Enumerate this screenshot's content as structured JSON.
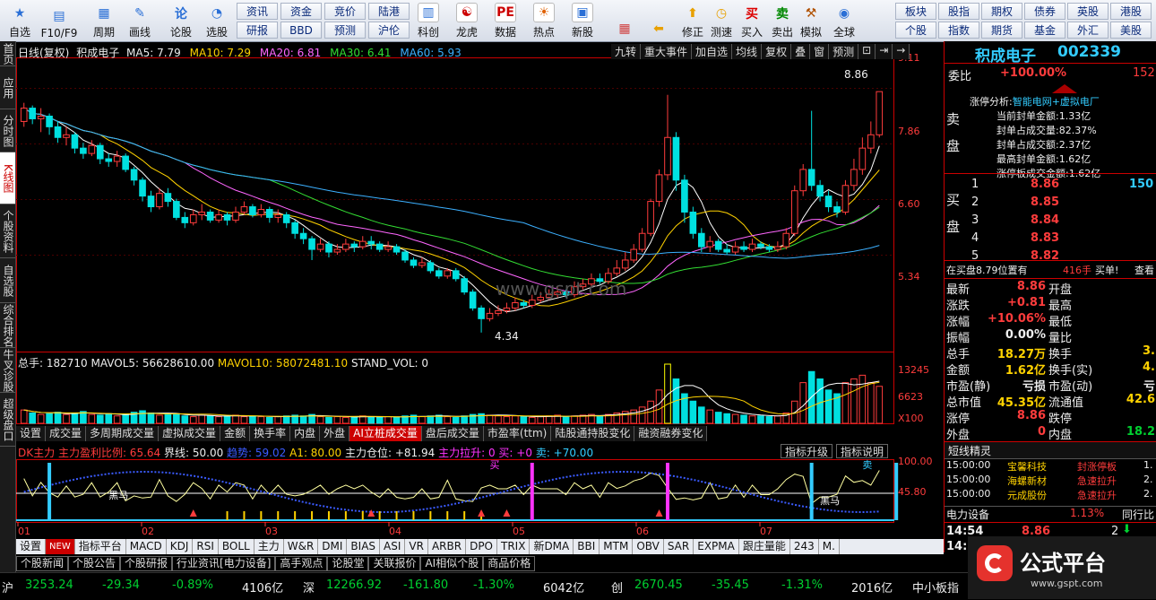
{
  "toolbar": {
    "big_buttons": [
      {
        "label": "自选",
        "icon": "star-icon",
        "x": 2
      },
      {
        "label": "F10/F9",
        "icon": "f10-icon",
        "x": 46
      },
      {
        "label": "周期",
        "icon": "period-icon",
        "x": 96
      },
      {
        "label": "画线",
        "icon": "pencil-icon",
        "x": 136
      },
      {
        "label": "论股",
        "icon": "forum-icon",
        "x": 182
      },
      {
        "label": "选股",
        "icon": "select-icon",
        "x": 222
      }
    ],
    "small_buttons_row1": [
      "资讯",
      "资金",
      "竞价",
      "陆港"
    ],
    "small_buttons_row2": [
      "研报",
      "BBD",
      "预测",
      "沪伦"
    ],
    "mid_buttons": [
      {
        "label": "科创",
        "icon": "chart-icon"
      },
      {
        "label": "龙虎",
        "icon": "dragon-icon"
      },
      {
        "label": "数据",
        "icon": "pe-icon"
      },
      {
        "label": "热点",
        "icon": "hot-icon"
      },
      {
        "label": "新股",
        "icon": "newstock-icon"
      }
    ],
    "right_buttons": [
      {
        "label": "",
        "icon": "grid-icon"
      },
      {
        "label": "",
        "icon": "back-arrow-icon"
      },
      {
        "label": "修正",
        "icon": "up-arrow-icon"
      },
      {
        "label": "测速",
        "icon": "speed-icon"
      },
      {
        "label": "买入",
        "icon": "buy-icon"
      },
      {
        "label": "卖出",
        "icon": "sell-icon"
      },
      {
        "label": "模拟",
        "icon": "hammer-icon"
      },
      {
        "label": "全球",
        "icon": "globe-icon"
      }
    ],
    "right_small_row1": [
      "板块",
      "股指",
      "期权",
      "债券",
      "英股",
      "港股"
    ],
    "right_small_row2": [
      "个股",
      "指数",
      "期货",
      "基金",
      "外汇",
      "美股"
    ]
  },
  "left_tabs": [
    "首页",
    "应用",
    "分时图",
    "K线图",
    "个股资料",
    "自选股",
    "综合排名",
    "牛叉诊股",
    "超级盘口"
  ],
  "chart_header": {
    "title": "日线(复权)",
    "name": "积成电子",
    "ma5": "MA5: 7.79",
    "ma10": "MA10: 7.29",
    "ma20": "MA20: 6.81",
    "ma30": "MA30: 6.41",
    "ma60": "MA60: 5.93",
    "tools": [
      "九转",
      "重大事件",
      "加自选",
      "均线",
      "复权",
      "叠",
      "窗",
      "预测"
    ],
    "tool_icons": [
      "lock-icon",
      "nav-icon",
      "arrow-icon"
    ]
  },
  "price_axis": [
    "9.11",
    "7.86",
    "6.60",
    "5.34"
  ],
  "price_high_label": "8.86",
  "price_low_label": "4.34",
  "volume_header": {
    "total": "总手: 182710",
    "mavol5": "MAVOL5: 56628610.00",
    "mavol10": "MAVOL10: 58072481.10",
    "stand": "STAND_VOL: 0"
  },
  "volume_axis": [
    "13245",
    "6623",
    "X100"
  ],
  "sub_tabs": [
    "设置",
    "成交量",
    "多周期成交量",
    "虚拟成交量",
    "金额",
    "换手率",
    "内盘",
    "外盘",
    "AI立桩成交量",
    "盘后成交量",
    "市盈率(ttm)",
    "陆股通持股变化",
    "融资融券变化"
  ],
  "sub_tabs_right": [
    "指标升级",
    "指标说明"
  ],
  "indicator_header": {
    "name": "DK主力",
    "ratio": "主力盈利比例: 65.64",
    "boundary": "界线: 50.00",
    "trend": "趋势: 59.02",
    "a1": "A1: 80.00",
    "position": "主力仓位: +81.94",
    "pull": "主力拉升: 0",
    "buy": "买: +0",
    "sell": "卖: +70.00"
  },
  "indicator_axis": [
    "100.00",
    "45.80"
  ],
  "indicator_labels": [
    "黑马",
    "黑马",
    "买",
    "卖"
  ],
  "date_axis": [
    "01",
    "02",
    "03",
    "04",
    "05",
    "06",
    "07"
  ],
  "indicator_tabs": [
    "设置",
    "NEW",
    "指标平台",
    "MACD",
    "KDJ",
    "RSI",
    "BOLL",
    "主力",
    "W&R",
    "DMI",
    "BIAS",
    "ASI",
    "VR",
    "ARBR",
    "DPO",
    "TRIX",
    "新DMA",
    "BBI",
    "MTM",
    "OBV",
    "SAR",
    "EXPMA",
    "跟庄量能",
    "243",
    "M."
  ],
  "news_tabs": [
    "个股新闻",
    "个股公告",
    "个股研报",
    "行业资讯[电力设备]",
    "高手观点",
    "论股堂",
    "关联报价",
    "AI相似个股",
    "商品价格"
  ],
  "watermark": "www.gspt.com",
  "right_panel": {
    "stock_name": "积成电子",
    "stock_code": "002339",
    "weibi_label": "委比",
    "weibi_value": "+100.00%",
    "weibi_extra": "152",
    "limit_up_title": "涨停分析:",
    "limit_up_concept": "智能电网+虚拟电厂",
    "limit_up_items": [
      {
        "label": "当前封单金额:",
        "value": "1.33亿"
      },
      {
        "label": "封单占成交量:",
        "value": "82.37%"
      },
      {
        "label": "封单占成交额:",
        "value": "2.37亿"
      },
      {
        "label": "最高封单金额:",
        "value": "1.62亿"
      },
      {
        "label": "涨停板成交金额:",
        "value": "1.62亿"
      }
    ],
    "sell_label": "卖盘",
    "buy_label": "买盘",
    "bids": [
      {
        "level": "1",
        "price": "8.86",
        "vol": "150"
      },
      {
        "level": "2",
        "price": "8.85",
        "vol": ""
      },
      {
        "level": "3",
        "price": "8.84",
        "vol": ""
      },
      {
        "level": "4",
        "price": "8.83",
        "vol": ""
      },
      {
        "level": "5",
        "price": "8.82",
        "vol": ""
      }
    ],
    "buy_queue": "在买盘8.79位置有",
    "buy_queue_vol": "416手",
    "buy_queue_btn": "买单!",
    "buy_queue_link": "查看",
    "quotes": [
      {
        "l1": "最新",
        "v1": "8.86",
        "c1": "red",
        "l2": "开盘",
        "v2": "",
        "c2": "red"
      },
      {
        "l1": "涨跌",
        "v1": "+0.81",
        "c1": "red",
        "l2": "最高",
        "v2": "",
        "c2": "red"
      },
      {
        "l1": "涨幅",
        "v1": "+10.06%",
        "c1": "red",
        "l2": "最低",
        "v2": "",
        "c2": "red"
      },
      {
        "l1": "振幅",
        "v1": "0.00%",
        "c1": "white",
        "l2": "量比",
        "v2": "",
        "c2": "white"
      },
      {
        "l1": "总手",
        "v1": "18.27万",
        "c1": "yellow",
        "l2": "换手",
        "v2": "3.",
        "c2": "yellow"
      },
      {
        "l1": "金额",
        "v1": "1.62亿",
        "c1": "yellow",
        "l2": "换手(实)",
        "v2": "4.",
        "c2": "yellow"
      },
      {
        "l1": "市盈(静)",
        "v1": "亏损",
        "c1": "white",
        "l2": "市盈(动)",
        "v2": "亏",
        "c2": "white"
      },
      {
        "l1": "总市值",
        "v1": "45.35亿",
        "c1": "yellow",
        "l2": "流通值",
        "v2": "42.6",
        "c2": "yellow"
      },
      {
        "l1": "涨停",
        "v1": "8.86",
        "c1": "red",
        "l2": "跌停",
        "v2": "",
        "c2": "green"
      },
      {
        "l1": "外盘",
        "v1": "0",
        "c1": "red",
        "l2": "内盘",
        "v2": "18.2",
        "c2": "green"
      }
    ],
    "short_wizard_title": "短线精灵",
    "short_wizard": [
      {
        "time": "15:00:00",
        "name": "宝馨科技",
        "event": "封涨停板",
        "val": "1."
      },
      {
        "time": "15:00:00",
        "name": "海螺新材",
        "event": "急速拉升",
        "val": "2."
      },
      {
        "time": "15:00:00",
        "name": "元成股份",
        "event": "急速拉升",
        "val": "2."
      }
    ],
    "sector_name": "电力设备",
    "sector_change": "1.13%",
    "sector_link": "同行比",
    "tick_time": "14:54",
    "tick_price": "8.86",
    "tick_vol": "2",
    "tick_time2": "14:5"
  },
  "status_bar": {
    "items": [
      {
        "label": "沪",
        "value": "3253.24",
        "chg": "-29.34",
        "pct": "-0.89%",
        "amt": "4106亿"
      },
      {
        "label": "深",
        "value": "12266.92",
        "chg": "-161.80",
        "pct": "-1.30%",
        "amt": "6042亿"
      },
      {
        "label": "创",
        "value": "2670.45",
        "chg": "-35.45",
        "pct": "-1.31%",
        "amt": "2016亿"
      }
    ],
    "tail": "中小板指"
  },
  "logo": {
    "text": "公式平台",
    "url_text": "www.gspt.com"
  },
  "colors": {
    "up": "#ff3c3c",
    "down": "#00e0e0",
    "ma5": "#ffffff",
    "ma10": "#ffd200",
    "ma20": "#ff66ff",
    "ma30": "#33dd33",
    "ma60": "#3cb0ff"
  },
  "chart_data": {
    "type": "candlestick",
    "ylim": [
      4.0,
      9.3
    ],
    "candles": [
      [
        8.3,
        8.55,
        8.65,
        8.2
      ],
      [
        8.55,
        8.35,
        8.6,
        8.25
      ],
      [
        8.35,
        8.4,
        8.55,
        8.1
      ],
      [
        8.4,
        8.2,
        8.45,
        8.05
      ],
      [
        8.2,
        8.0,
        8.3,
        7.9
      ],
      [
        8.0,
        8.05,
        8.2,
        7.85
      ],
      [
        8.05,
        7.8,
        8.1,
        7.7
      ],
      [
        7.8,
        7.7,
        7.9,
        7.6
      ],
      [
        7.7,
        7.85,
        7.95,
        7.65
      ],
      [
        7.85,
        7.6,
        7.9,
        7.5
      ],
      [
        7.6,
        7.55,
        7.7,
        7.45
      ],
      [
        7.55,
        7.65,
        7.75,
        7.45
      ],
      [
        7.65,
        7.4,
        7.7,
        7.35
      ],
      [
        7.4,
        7.2,
        7.45,
        7.1
      ],
      [
        7.2,
        6.9,
        7.25,
        6.8
      ],
      [
        6.9,
        6.7,
        7.0,
        6.6
      ],
      [
        6.7,
        6.95,
        7.05,
        6.65
      ],
      [
        6.95,
        6.8,
        7.05,
        6.7
      ],
      [
        6.8,
        6.5,
        6.85,
        6.45
      ],
      [
        6.5,
        6.4,
        6.6,
        6.3
      ],
      [
        6.4,
        6.55,
        6.65,
        6.35
      ],
      [
        6.55,
        6.6,
        6.75,
        6.45
      ],
      [
        6.6,
        6.45,
        6.65,
        6.4
      ],
      [
        6.45,
        6.55,
        6.65,
        6.4
      ],
      [
        6.55,
        6.45,
        6.6,
        6.35
      ],
      [
        6.45,
        6.6,
        6.7,
        6.4
      ],
      [
        6.6,
        6.7,
        6.8,
        6.55
      ],
      [
        6.7,
        6.55,
        6.75,
        6.5
      ],
      [
        6.55,
        6.65,
        6.75,
        6.5
      ],
      [
        6.65,
        6.5,
        6.7,
        6.4
      ],
      [
        6.5,
        6.55,
        6.65,
        6.4
      ],
      [
        6.55,
        6.4,
        6.6,
        6.3
      ],
      [
        6.4,
        6.2,
        6.45,
        6.1
      ],
      [
        6.2,
        6.1,
        6.3,
        6.0
      ],
      [
        6.1,
        5.9,
        6.15,
        5.7
      ],
      [
        5.9,
        6.0,
        6.1,
        5.85
      ],
      [
        6.0,
        5.85,
        6.05,
        5.75
      ],
      [
        5.85,
        5.9,
        6.0,
        5.8
      ],
      [
        5.9,
        6.0,
        6.1,
        5.85
      ],
      [
        6.0,
        5.95,
        6.05,
        5.85
      ],
      [
        5.95,
        6.05,
        6.15,
        5.9
      ],
      [
        6.05,
        6.0,
        6.15,
        5.9
      ],
      [
        6.0,
        5.9,
        6.05,
        5.85
      ],
      [
        5.9,
        5.95,
        6.05,
        5.85
      ],
      [
        5.95,
        5.85,
        6.0,
        5.8
      ],
      [
        5.85,
        5.7,
        5.9,
        5.65
      ],
      [
        5.7,
        5.6,
        5.75,
        5.55
      ],
      [
        5.6,
        5.65,
        5.75,
        5.55
      ],
      [
        5.65,
        5.5,
        5.7,
        5.45
      ],
      [
        5.5,
        5.4,
        5.55,
        5.35
      ],
      [
        5.4,
        5.5,
        5.55,
        5.35
      ],
      [
        5.5,
        5.35,
        5.55,
        5.3
      ],
      [
        5.35,
        5.1,
        5.4,
        5.05
      ],
      [
        5.1,
        4.8,
        5.15,
        4.75
      ],
      [
        4.8,
        4.6,
        4.85,
        4.34
      ],
      [
        4.6,
        4.7,
        4.8,
        4.55
      ],
      [
        4.7,
        4.75,
        4.85,
        4.65
      ],
      [
        4.75,
        4.8,
        4.9,
        4.7
      ],
      [
        4.8,
        4.9,
        5.0,
        4.75
      ],
      [
        4.9,
        4.85,
        4.95,
        4.8
      ],
      [
        4.85,
        4.95,
        5.05,
        4.8
      ],
      [
        4.95,
        5.0,
        5.1,
        4.9
      ],
      [
        5.0,
        5.05,
        5.15,
        4.95
      ],
      [
        5.05,
        5.1,
        5.2,
        5.0
      ],
      [
        5.1,
        5.05,
        5.15,
        5.0
      ],
      [
        5.05,
        5.2,
        5.3,
        5.0
      ],
      [
        5.2,
        5.25,
        5.35,
        5.15
      ],
      [
        5.25,
        5.35,
        5.45,
        5.2
      ],
      [
        5.35,
        5.3,
        5.45,
        5.25
      ],
      [
        5.3,
        5.45,
        5.55,
        5.25
      ],
      [
        5.45,
        5.55,
        5.7,
        5.4
      ],
      [
        5.55,
        5.7,
        5.85,
        5.5
      ],
      [
        5.7,
        5.9,
        6.0,
        5.65
      ],
      [
        5.9,
        6.2,
        6.3,
        5.85
      ],
      [
        6.2,
        6.8,
        6.85,
        6.15
      ],
      [
        6.8,
        7.3,
        7.4,
        6.7
      ],
      [
        7.3,
        8.0,
        8.8,
        7.2
      ],
      [
        8.0,
        7.2,
        8.1,
        7.0
      ],
      [
        7.2,
        6.6,
        7.3,
        6.4
      ],
      [
        6.6,
        6.2,
        6.7,
        6.1
      ],
      [
        6.2,
        5.95,
        6.3,
        5.85
      ],
      [
        5.95,
        6.05,
        6.15,
        5.85
      ],
      [
        6.05,
        5.9,
        6.1,
        5.85
      ],
      [
        5.9,
        5.85,
        6.0,
        5.8
      ],
      [
        5.85,
        5.95,
        6.05,
        5.8
      ],
      [
        5.95,
        5.9,
        6.05,
        5.85
      ],
      [
        5.9,
        6.0,
        6.1,
        5.85
      ],
      [
        6.0,
        5.95,
        6.05,
        5.9
      ],
      [
        5.95,
        5.9,
        6.0,
        5.85
      ],
      [
        5.9,
        5.95,
        6.05,
        5.85
      ],
      [
        5.95,
        6.2,
        6.3,
        5.9
      ],
      [
        6.2,
        7.0,
        7.1,
        6.15
      ],
      [
        7.0,
        7.4,
        7.5,
        6.9
      ],
      [
        7.4,
        7.1,
        8.5,
        7.0
      ],
      [
        7.1,
        6.9,
        7.2,
        6.8
      ],
      [
        6.9,
        6.7,
        7.0,
        6.6
      ],
      [
        6.7,
        6.6,
        6.8,
        6.5
      ],
      [
        6.6,
        7.1,
        7.2,
        6.55
      ],
      [
        7.1,
        7.4,
        7.6,
        7.0
      ],
      [
        7.4,
        7.8,
        8.0,
        7.3
      ],
      [
        7.8,
        8.05,
        8.3,
        7.7
      ],
      [
        8.05,
        8.86,
        8.86,
        8.0
      ]
    ],
    "volume": [
      18,
      14,
      12,
      13,
      15,
      12,
      14,
      16,
      12,
      11,
      13,
      10,
      12,
      15,
      17,
      14,
      11,
      12,
      13,
      10,
      9,
      11,
      10,
      9,
      10,
      11,
      9,
      10,
      9,
      8,
      9,
      10,
      11,
      10,
      12,
      9,
      8,
      9,
      8,
      9,
      10,
      9,
      8,
      9,
      8,
      10,
      11,
      9,
      10,
      11,
      9,
      8,
      10,
      12,
      13,
      11,
      10,
      9,
      10,
      9,
      8,
      9,
      10,
      11,
      9,
      10,
      11,
      12,
      10,
      12,
      14,
      16,
      18,
      22,
      30,
      45,
      80,
      60,
      40,
      30,
      22,
      18,
      15,
      13,
      12,
      11,
      10,
      10,
      9,
      10,
      14,
      30,
      55,
      70,
      60,
      45,
      40,
      55,
      60,
      65,
      55,
      50
    ],
    "limit_days": [
      76,
      93,
      103
    ]
  }
}
